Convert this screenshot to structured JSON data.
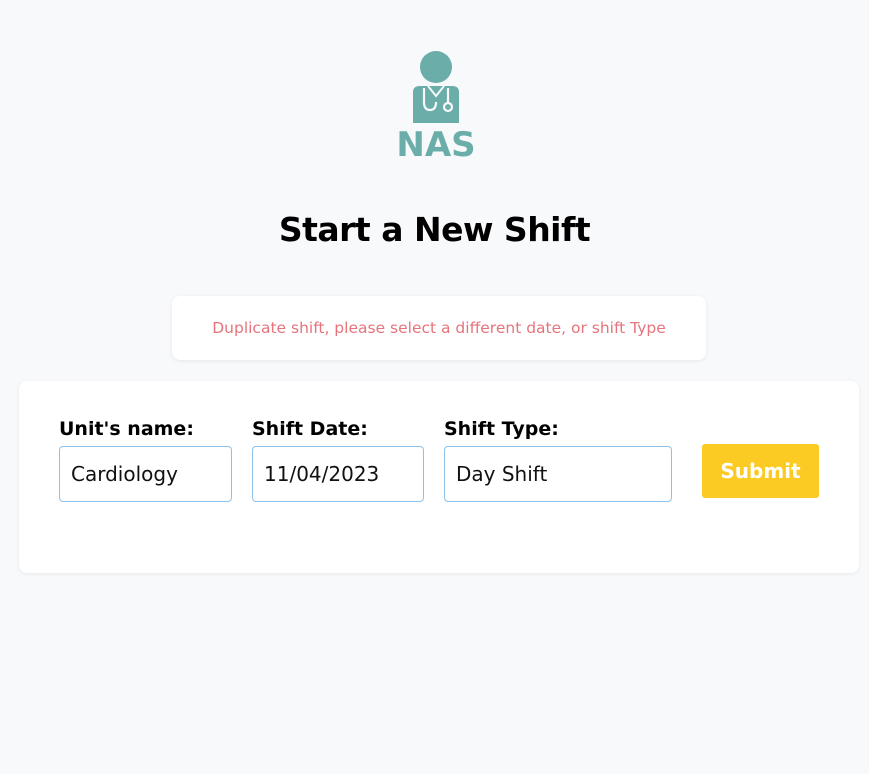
{
  "brand": {
    "logo_text": "NAS",
    "logo_color": "#6aada9"
  },
  "page": {
    "title": "Start a New Shift"
  },
  "alert": {
    "message": "Duplicate shift, please select a different date, or shift Type",
    "color": "#e6747c"
  },
  "form": {
    "unit_label": "Unit's name:",
    "unit_value": "Cardiology",
    "date_label": "Shift Date:",
    "date_value": "11/04/2023",
    "type_label": "Shift Type:",
    "type_value": "Day Shift",
    "submit_label": "Submit",
    "submit_color": "#fbcb24"
  }
}
